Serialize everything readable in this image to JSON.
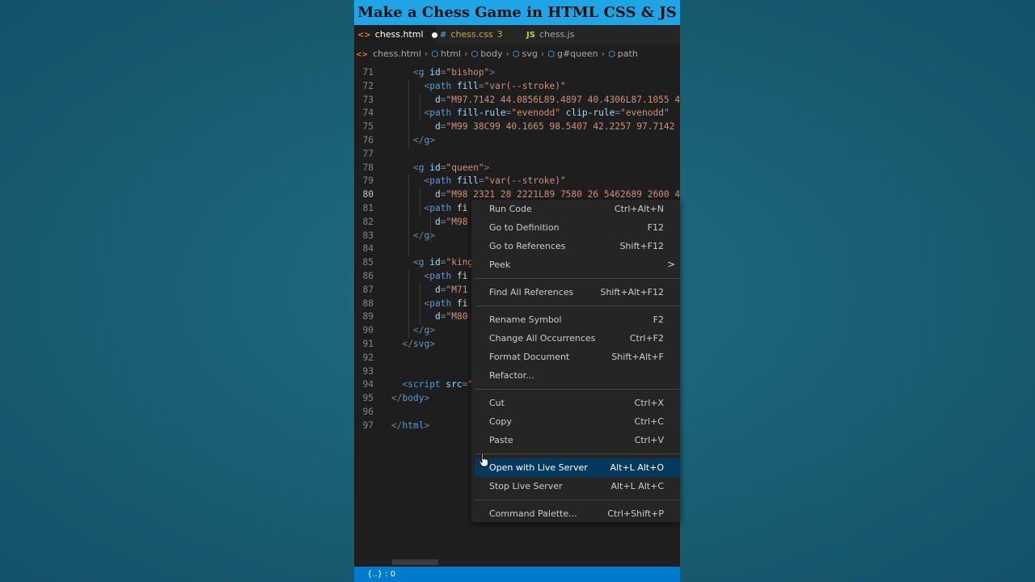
{
  "banner": {
    "title": "Make a Chess Game in HTML CSS & JS"
  },
  "tabs": [
    {
      "icon": "<>",
      "label": "chess.html"
    },
    {
      "icon": "#",
      "label": "chess.css",
      "badge": "3"
    },
    {
      "icon": "JS",
      "label": "chess.js"
    }
  ],
  "breadcrumb": [
    "chess.html",
    "html",
    "body",
    "svg",
    "g#queen",
    "path"
  ],
  "code_lines": [
    {
      "n": "71",
      "t": "<g id=\"bishop\">"
    },
    {
      "n": "72",
      "t": "<path fill=\"var(--stroke)\""
    },
    {
      "n": "73",
      "t": "d=\"M97.7142 44.0856L89.4897 40.4306L87.1055 4"
    },
    {
      "n": "74",
      "t": "<path fill-rule=\"evenodd\" clip-rule=\"evenodd\""
    },
    {
      "n": "75",
      "t": "d=\"M99 38C99 40.1665 98.5407 42.2257 97.7142"
    },
    {
      "n": "76",
      "t": "</g>"
    },
    {
      "n": "77",
      "t": ""
    },
    {
      "n": "78",
      "t": "<g id=\"queen\">"
    },
    {
      "n": "79",
      "t": "<path fill=\"var(--stroke)\""
    },
    {
      "n": "80",
      "t": "d=\"M98 2321 28 2221L89 7580 26 5462689 2600 4"
    },
    {
      "n": "81",
      "t": "<path fi"
    },
    {
      "n": "82",
      "t": "d=\"M98"
    },
    {
      "n": "83",
      "t": "</g>"
    },
    {
      "n": "84",
      "t": ""
    },
    {
      "n": "85",
      "t": "<g id=\"king"
    },
    {
      "n": "86",
      "t": "<path fi"
    },
    {
      "n": "87",
      "t": "d=\"M71"
    },
    {
      "n": "88",
      "t": "<path fi"
    },
    {
      "n": "89",
      "t": "d=\"M80"
    },
    {
      "n": "90",
      "t": "</g>"
    },
    {
      "n": "91",
      "t": "</svg>"
    },
    {
      "n": "92",
      "t": ""
    },
    {
      "n": "93",
      "t": ""
    },
    {
      "n": "94",
      "t": "<script src=\""
    },
    {
      "n": "95",
      "t": "</body>"
    },
    {
      "n": "96",
      "t": ""
    },
    {
      "n": "97",
      "t": "</html>"
    }
  ],
  "context_menu": {
    "groups": [
      [
        {
          "label": "Run Code",
          "key": "Ctrl+Alt+N"
        },
        {
          "label": "Go to Definition",
          "key": "F12"
        },
        {
          "label": "Go to References",
          "key": "Shift+F12"
        },
        {
          "label": "Peek",
          "key": "",
          "submenu": ">"
        }
      ],
      [
        {
          "label": "Find All References",
          "key": "Shift+Alt+F12"
        }
      ],
      [
        {
          "label": "Rename Symbol",
          "key": "F2"
        },
        {
          "label": "Change All Occurrences",
          "key": "Ctrl+F2"
        },
        {
          "label": "Format Document",
          "key": "Shift+Alt+F"
        },
        {
          "label": "Refactor...",
          "key": ""
        }
      ],
      [
        {
          "label": "Cut",
          "key": "Ctrl+X"
        },
        {
          "label": "Copy",
          "key": "Ctrl+C"
        },
        {
          "label": "Paste",
          "key": "Ctrl+V"
        }
      ],
      [
        {
          "label": "Open with Live Server",
          "key": "Alt+L Alt+O",
          "highlighted": true
        },
        {
          "label": "Stop Live Server",
          "key": "Alt+L Alt+C"
        }
      ],
      [
        {
          "label": "Command Palette...",
          "key": "Ctrl+Shift+P"
        }
      ]
    ]
  },
  "status_bar": {
    "text": "{..} : 0"
  },
  "colors": {
    "background": "#1b6478",
    "banner": "#1fa5e6",
    "editor": "#1e1e1e",
    "menu": "#252526",
    "menu_highlight": "#04395e",
    "status_bar": "#007acc"
  }
}
